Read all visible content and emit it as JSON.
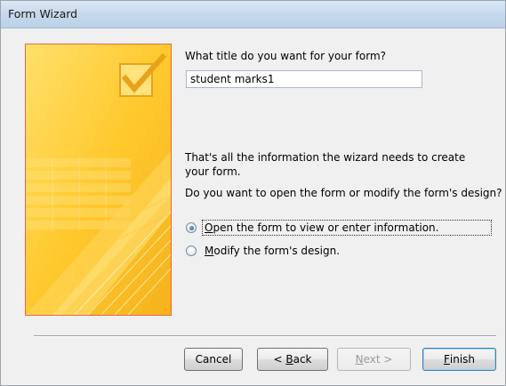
{
  "window": {
    "title": "Form Wizard"
  },
  "prompt_title": "What title do you want for your form?",
  "title_input_value": "student marks1",
  "info_text": "That's all the information the wizard needs to create your form.",
  "question_text": "Do you want to open the form or modify the form's design?",
  "options": [
    {
      "accel": "O",
      "rest": "pen the form to view or enter information.",
      "checked": true
    },
    {
      "accel": "M",
      "rest": "odify the form's design.",
      "checked": false
    }
  ],
  "buttons": {
    "cancel": {
      "label": "Cancel"
    },
    "back": {
      "label_prefix": "< ",
      "accel": "B",
      "label_rest": "ack"
    },
    "next": {
      "accel": "N",
      "label_rest": "ext >",
      "disabled": true
    },
    "finish": {
      "accel": "F",
      "label_rest": "inish"
    }
  },
  "colors": {
    "artwork_yellow": "#ffd24a",
    "artwork_border": "#e36a4a",
    "radio_selected": "#2a6fb6"
  }
}
